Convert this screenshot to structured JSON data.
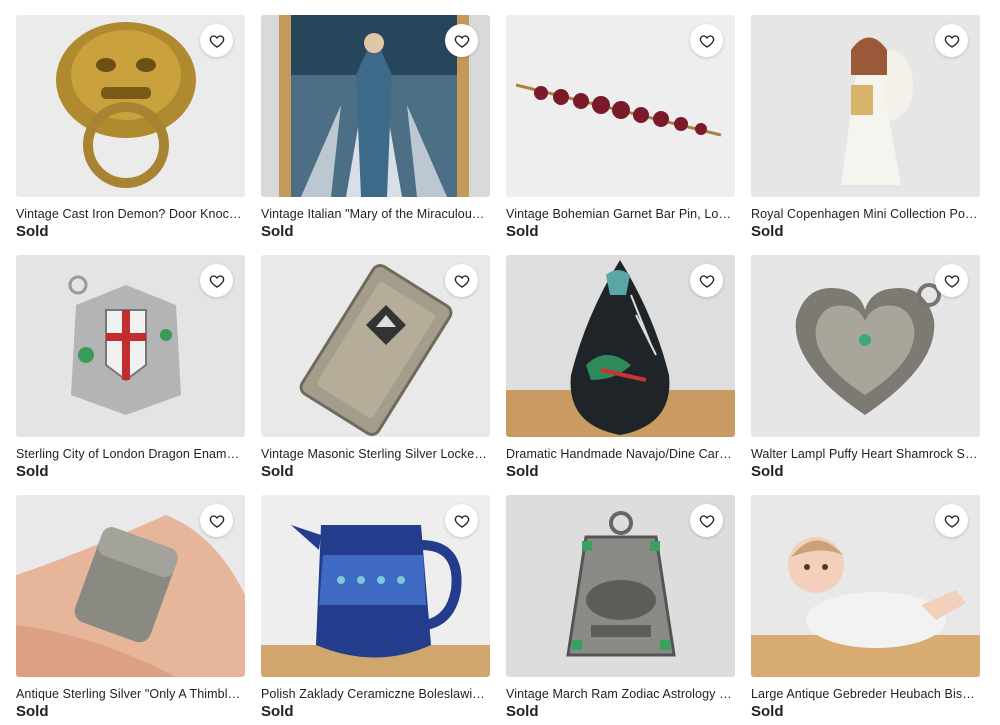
{
  "listings": [
    {
      "title": "Vintage Cast Iron Demon? Door Knocker",
      "status": "Sold",
      "image": "brass-door-knocker",
      "bg": "#ebebeb"
    },
    {
      "title": "Vintage Italian \"Mary of the Miraculous Medal\"",
      "status": "Sold",
      "image": "framed-mary-print",
      "bg": "#c8a06a"
    },
    {
      "title": "Vintage Bohemian Garnet Bar Pin, Lovely",
      "status": "Sold",
      "image": "garnet-bar-pin",
      "bg": "#eeeeee"
    },
    {
      "title": "Royal Copenhagen Mini Collection Porcelain Angel",
      "status": "Sold",
      "image": "porcelain-angel",
      "bg": "#e6e6e6"
    },
    {
      "title": "Sterling City of London Dragon Enamel Charm",
      "status": "Sold",
      "image": "london-crest-charm",
      "bg": "#e4e4e4"
    },
    {
      "title": "Vintage Masonic Sterling Silver Locket Pendant",
      "status": "Sold",
      "image": "masonic-locket",
      "bg": "#e9e9e9"
    },
    {
      "title": "Dramatic Handmade Navajo/Dine Carved Vase",
      "status": "Sold",
      "image": "navajo-vase",
      "bg": "#e2e2e2"
    },
    {
      "title": "Walter Lampl Puffy Heart Shamrock Sterling Charm",
      "status": "Sold",
      "image": "shamrock-heart",
      "bg": "#e6e6e6"
    },
    {
      "title": "Antique Sterling Silver \"Only A Thimbleful\"",
      "status": "Sold",
      "image": "silver-thimble",
      "bg": "#e9e9e9"
    },
    {
      "title": "Polish Zaklady Ceramiczne Boleslawiec Pitcher",
      "status": "Sold",
      "image": "polish-pitcher",
      "bg": "#eeeeee"
    },
    {
      "title": "Vintage March Ram Zodiac Astrology Charm",
      "status": "Sold",
      "image": "march-ram-charm",
      "bg": "#dddddd"
    },
    {
      "title": "Large Antique Gebreder Heubach Bisque Baby",
      "status": "Sold",
      "image": "bisque-baby",
      "bg": "#e8e8e8"
    }
  ],
  "favorite_icon": "heart-outline-icon"
}
